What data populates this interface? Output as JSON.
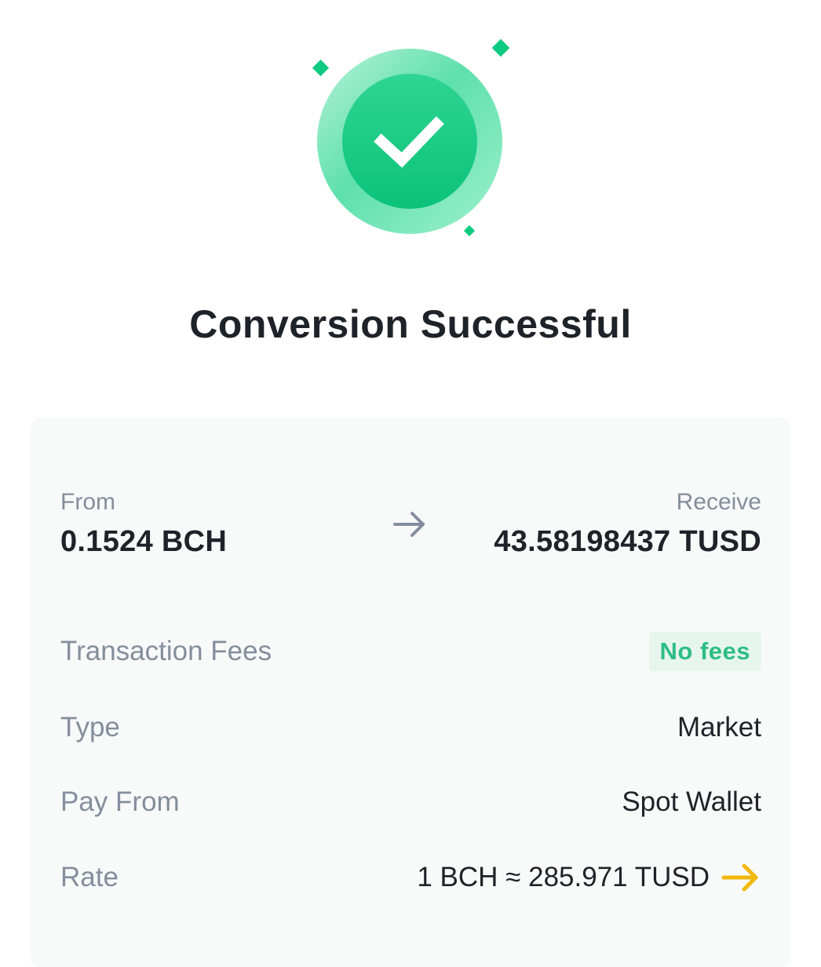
{
  "title": "Conversion Successful",
  "conversion": {
    "from_label": "From",
    "from_amount": "0.1524 BCH",
    "receive_label": "Receive",
    "receive_amount": "43.58198437 TUSD"
  },
  "details": {
    "fees_label": "Transaction Fees",
    "fees_value": "No fees",
    "type_label": "Type",
    "type_value": "Market",
    "pay_from_label": "Pay From",
    "pay_from_value": "Spot Wallet",
    "rate_label": "Rate",
    "rate_value": "1 BCH ≈ 285.971 TUSD"
  },
  "icons": {
    "success": "check-circle-icon",
    "convert": "arrow-right-icon",
    "rate_refresh": "arrow-right-icon"
  },
  "colors": {
    "success_green": "#0ecb81",
    "text_primary": "#1e2329",
    "text_secondary": "#848e9c",
    "card_bg": "#f8f9f9",
    "badge_bg": "#e6f6ee",
    "badge_text": "#2ebd85",
    "accent_yellow": "#f0b90b"
  }
}
